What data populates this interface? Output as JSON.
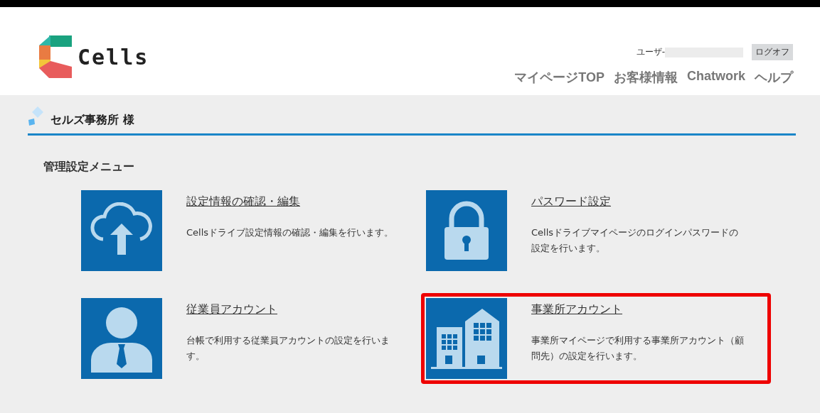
{
  "header": {
    "logo_text": "Cells",
    "user_label": "ユーザ-",
    "logoff_button": "ログオフ",
    "nav": [
      "マイページTOP",
      "お客様情報",
      "Chatwork",
      "ヘルプ"
    ]
  },
  "page_title": "セルズ事務所 様",
  "section_title": "管理設定メニュー",
  "menu_items": [
    {
      "kind": "cloud",
      "title": "設定情報の確認・編集",
      "description": "Cellsドライブ設定情報の確認・編集を行います。",
      "highlighted": false
    },
    {
      "kind": "lock",
      "title": "パスワード設定",
      "description": "Cellsドライブマイページのログインパスワードの設定を行います。",
      "highlighted": false
    },
    {
      "kind": "person",
      "title": "従業員アカウント",
      "description": "台帳で利用する従業員アカウントの設定を行います。",
      "highlighted": false
    },
    {
      "kind": "building",
      "title": "事業所アカウント",
      "description": "事業所マイページで利用する事業所アカウント（顧問先）の設定を行います。",
      "highlighted": true
    }
  ]
}
